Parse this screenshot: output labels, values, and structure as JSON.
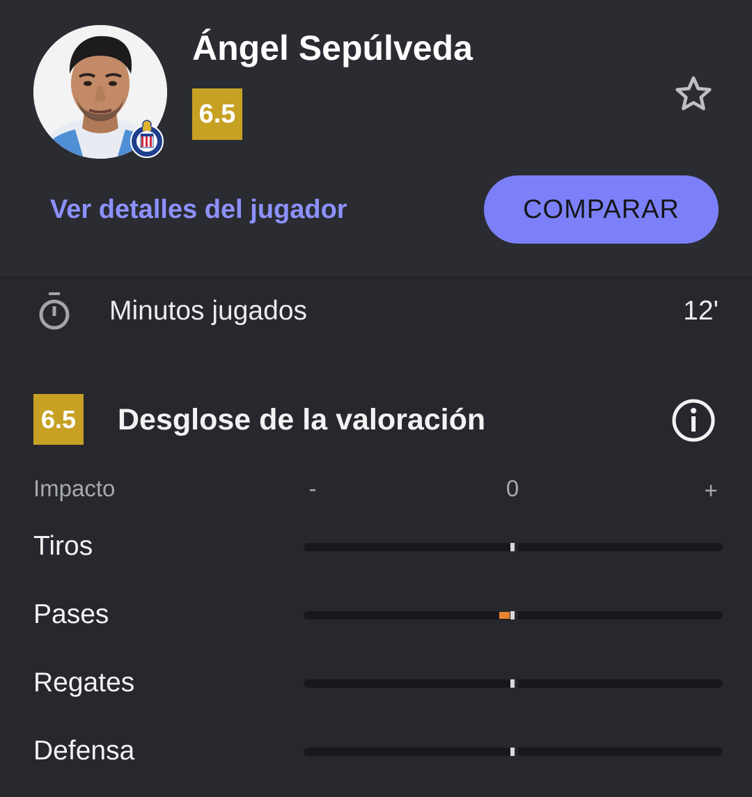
{
  "player": {
    "name": "Ángel Sepúlveda",
    "rating": "6.5",
    "details_link": "Ver detalles del jugador",
    "compare_button": "COMPARAR"
  },
  "minutes": {
    "label": "Minutos jugados",
    "value": "12'"
  },
  "breakdown": {
    "rating": "6.5",
    "title": "Desglose de la valoración",
    "impact_label": "Impacto",
    "scale": {
      "minus": "-",
      "zero": "0",
      "plus": "+"
    },
    "stats": [
      {
        "label": "Tiros",
        "impact": 0
      },
      {
        "label": "Pases",
        "impact": -0.05
      },
      {
        "label": "Regates",
        "impact": 0
      },
      {
        "label": "Defensa",
        "impact": 0
      }
    ]
  },
  "colors": {
    "background": "#26282d",
    "rating_badge": "#c7a124",
    "accent": "#7c80f8",
    "negative_impact": "#e98532"
  },
  "icons": [
    "star-outline-icon",
    "stopwatch-icon",
    "info-icon",
    "club-crest-icon"
  ]
}
